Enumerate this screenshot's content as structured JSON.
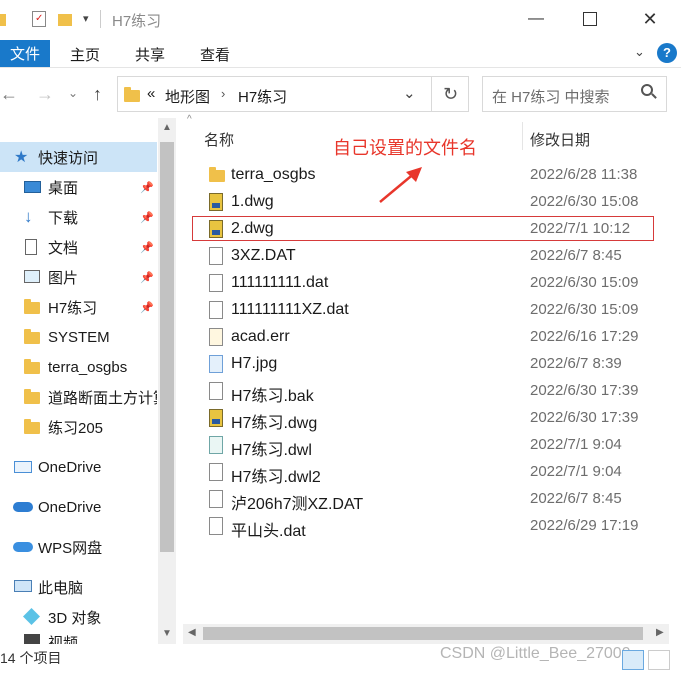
{
  "window": {
    "title": "H7练习"
  },
  "ribbon": {
    "tabs": [
      "文件",
      "主页",
      "共享",
      "查看"
    ]
  },
  "address": {
    "overflow": "«",
    "parts": [
      "地形图",
      "H7练习"
    ]
  },
  "search": {
    "placeholder": "在 H7练习 中搜索"
  },
  "sidebar": {
    "quick_access": "快速访问",
    "items": [
      "桌面",
      "下载",
      "文档",
      "图片",
      "H7练习",
      "SYSTEM",
      "terra_osgbs",
      "道路断面土方计算",
      "练习205"
    ],
    "onedrive1": "OneDrive",
    "onedrive2": "OneDrive",
    "wps": "WPS网盘",
    "pc": "此电脑",
    "obj3d": "3D 对象",
    "video": "视频"
  },
  "columns": {
    "name": "名称",
    "date": "修改日期"
  },
  "files": [
    {
      "name": "terra_osgbs",
      "date": "2022/6/28 11:38",
      "icon": "folder"
    },
    {
      "name": "1.dwg",
      "date": "2022/6/30 15:08",
      "icon": "dwg"
    },
    {
      "name": "2.dwg",
      "date": "2022/7/1 10:12",
      "icon": "dwg"
    },
    {
      "name": "3XZ.DAT",
      "date": "2022/6/7 8:45",
      "icon": "doc"
    },
    {
      "name": "111111111.dat",
      "date": "2022/6/30 15:09",
      "icon": "doc"
    },
    {
      "name": "111111111XZ.dat",
      "date": "2022/6/30 15:09",
      "icon": "doc"
    },
    {
      "name": "acad.err",
      "date": "2022/6/16 17:29",
      "icon": "err"
    },
    {
      "name": "H7.jpg",
      "date": "2022/6/7 8:39",
      "icon": "img"
    },
    {
      "name": "H7练习.bak",
      "date": "2022/6/30 17:39",
      "icon": "doc"
    },
    {
      "name": "H7练习.dwg",
      "date": "2022/6/30 17:39",
      "icon": "dwg"
    },
    {
      "name": "H7练习.dwl",
      "date": "2022/7/1 9:04",
      "icon": "dwl"
    },
    {
      "name": "H7练习.dwl2",
      "date": "2022/7/1 9:04",
      "icon": "doc"
    },
    {
      "name": "泸206h7测XZ.DAT",
      "date": "2022/6/7 8:45",
      "icon": "doc"
    },
    {
      "name": "平山头.dat",
      "date": "2022/6/29 17:19",
      "icon": "doc"
    }
  ],
  "status": {
    "count": "14 个项目"
  },
  "annotation": {
    "text": "自己设置的文件名"
  },
  "watermark": "CSDN @Little_Bee_27000",
  "colors": {
    "accent": "#1979ca",
    "annotation": "#e8362b",
    "folder": "#f0c04a"
  }
}
